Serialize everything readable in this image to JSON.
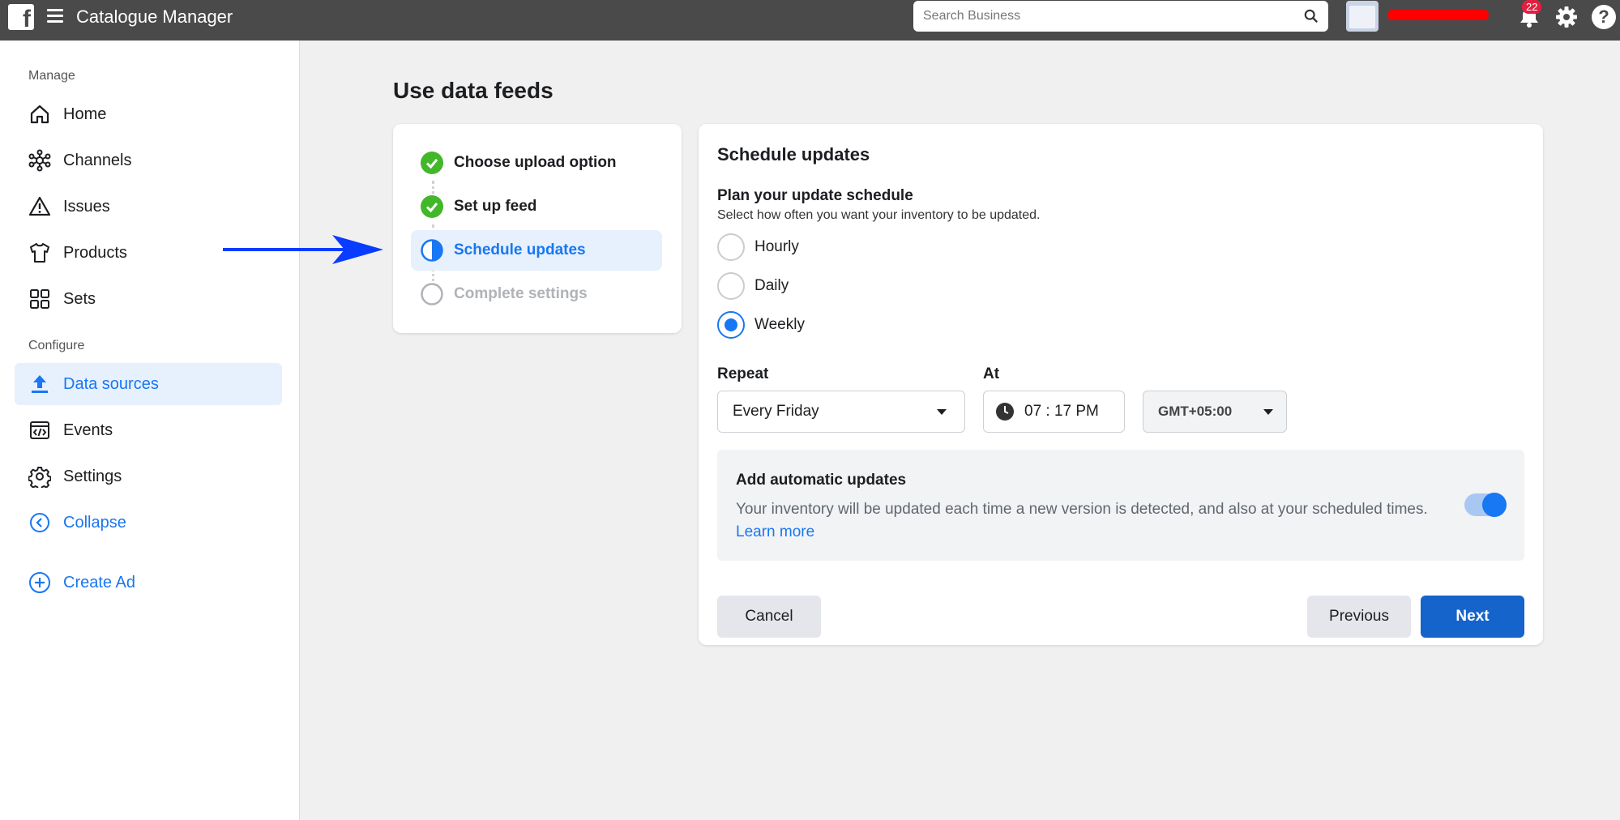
{
  "header": {
    "app_title": "Catalogue Manager",
    "search_placeholder": "Search Business",
    "notification_count": "22"
  },
  "sidebar": {
    "manage_label": "Manage",
    "configure_label": "Configure",
    "items": [
      {
        "label": "Home",
        "icon": "home-icon"
      },
      {
        "label": "Channels",
        "icon": "channels-icon"
      },
      {
        "label": "Issues",
        "icon": "warning-icon"
      },
      {
        "label": "Products",
        "icon": "shirt-icon"
      },
      {
        "label": "Sets",
        "icon": "grid-icon"
      },
      {
        "label": "Data sources",
        "icon": "upload-icon",
        "active": true
      },
      {
        "label": "Events",
        "icon": "code-window-icon"
      },
      {
        "label": "Settings",
        "icon": "gear-icon"
      },
      {
        "label": "Collapse",
        "icon": "chevron-left-circle-icon"
      },
      {
        "label": "Create Ad",
        "icon": "plus-circle-icon"
      }
    ]
  },
  "main": {
    "page_title": "Use data feeds",
    "steps": [
      {
        "label": "Choose upload option",
        "status": "complete"
      },
      {
        "label": "Set up feed",
        "status": "complete"
      },
      {
        "label": "Schedule updates",
        "status": "current"
      },
      {
        "label": "Complete settings",
        "status": "todo"
      }
    ],
    "schedule": {
      "title": "Schedule updates",
      "plan_title": "Plan your update schedule",
      "plan_desc": "Select how often you want your inventory to be updated.",
      "options": [
        "Hourly",
        "Daily",
        "Weekly"
      ],
      "selected_option": "Weekly",
      "repeat_label": "Repeat",
      "repeat_value": "Every Friday",
      "at_label": "At",
      "time_value": "07 : 17 PM",
      "timezone_value": "GMT+05:00",
      "auto_title": "Add automatic updates",
      "auto_desc": "Your inventory will be updated each time a new version is detected, and also at your scheduled times.",
      "learn_more": "Learn more",
      "auto_enabled": true,
      "cancel_label": "Cancel",
      "previous_label": "Previous",
      "next_label": "Next"
    }
  },
  "colors": {
    "accent": "#1877f2",
    "topbar": "#4a4a4a",
    "success": "#42b72a",
    "primary_button": "#1464cc"
  }
}
